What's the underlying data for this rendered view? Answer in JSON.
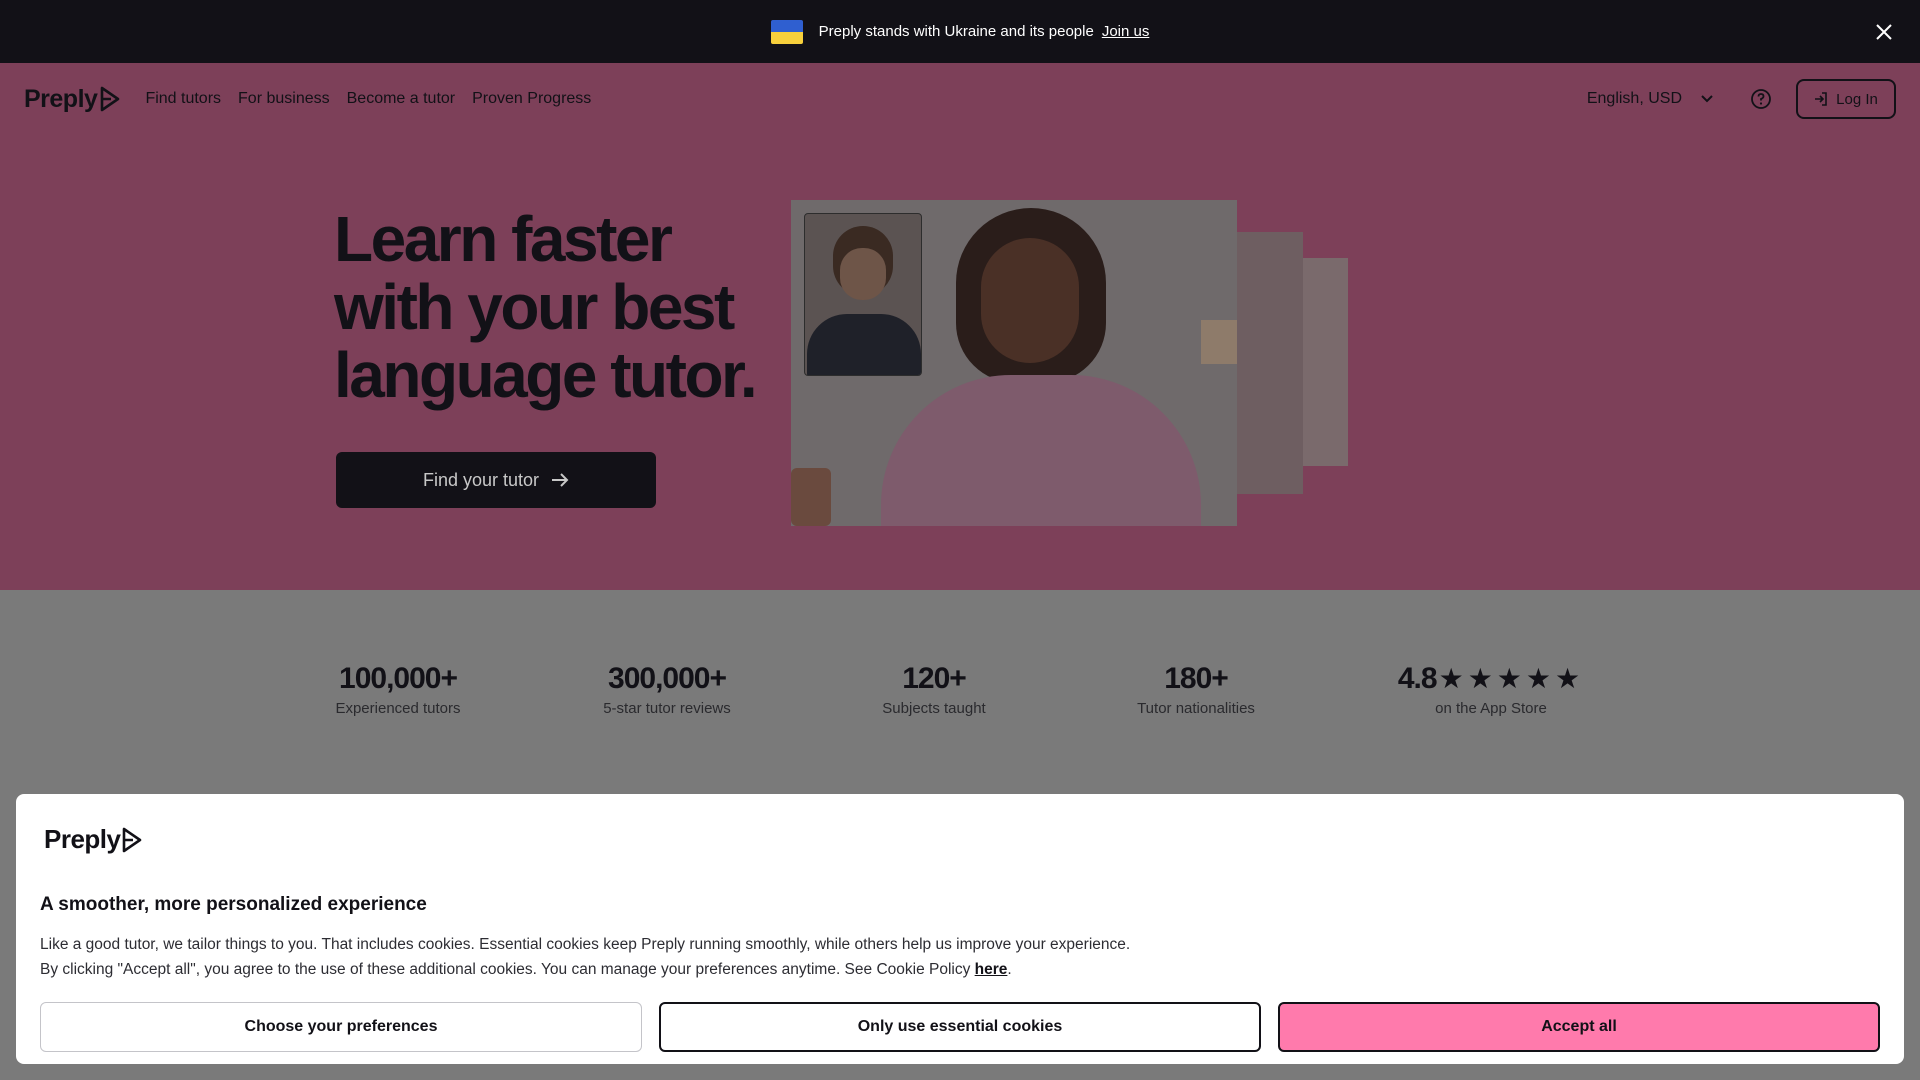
{
  "banner": {
    "text": "Preply stands with Ukraine and its people",
    "link": "Join us"
  },
  "nav": {
    "brand": "Preply",
    "links": [
      "Find tutors",
      "For business",
      "Become a tutor",
      "Proven Progress"
    ],
    "language": "English, USD",
    "login": "Log In"
  },
  "hero": {
    "title": "Learn faster with your best language tutor.",
    "cta": "Find your tutor"
  },
  "stats": [
    {
      "value": "100,000+",
      "label": "Experienced tutors"
    },
    {
      "value": "300,000+",
      "label": "5-star tutor reviews"
    },
    {
      "value": "120+",
      "label": "Subjects taught"
    },
    {
      "value": "180+",
      "label": "Tutor nationalities"
    },
    {
      "value": "4.8",
      "label": "on the App Store",
      "stars": "★★★★★"
    }
  ],
  "cookie": {
    "brand": "Preply",
    "title": "A smoother, more personalized experience",
    "line1": "Like a good tutor, we tailor things to you. That includes cookies. Essential cookies keep Preply running smoothly, while others help us improve your experience.",
    "line2": "By clicking \"Accept all\", you agree to the use of these additional cookies. You can manage your preferences anytime. See Cookie Policy ",
    "link": "here",
    "buttons": {
      "preferences": "Choose your preferences",
      "essential": "Only use essential cookies",
      "accept": "Accept all"
    }
  },
  "colors": {
    "hero_bg": "#7d4059",
    "accent_pink": "#ff7aac",
    "dark": "#121117"
  }
}
